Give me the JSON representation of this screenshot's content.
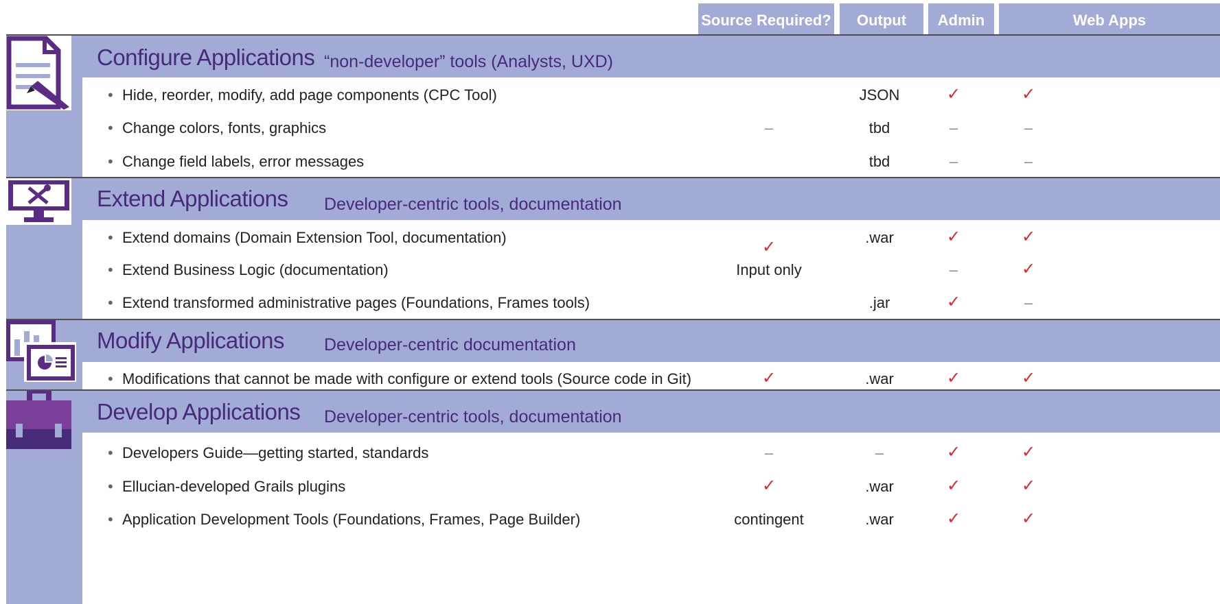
{
  "header": {
    "columns": [
      "Source Required?",
      "Output",
      "Admin",
      "Web Apps"
    ]
  },
  "sections": [
    {
      "title": "Configure Applications",
      "subtitle": "“non-developer” tools (Analysts, UXD)",
      "icon": "document-pencil-icon",
      "rows": [
        {
          "text": "Hide, reorder, modify, add page components (CPC Tool)",
          "source": "",
          "output": "JSON",
          "admin": "✓",
          "web": "✓"
        },
        {
          "text": "Change colors, fonts, graphics",
          "source": "–",
          "output": "tbd",
          "admin": "–",
          "web": "–"
        },
        {
          "text": "Change field labels, error messages",
          "source": "",
          "output": "tbd",
          "admin": "–",
          "web": "–"
        }
      ]
    },
    {
      "title": "Extend Applications",
      "subtitle": "Developer-centric tools, documentation",
      "icon": "monitor-tools-icon",
      "source_merged": {
        "check": "✓",
        "label": "Input only"
      },
      "rows": [
        {
          "text": "Extend domains (Domain Extension Tool, documentation)",
          "source": "",
          "output": ".war",
          "admin": "✓",
          "web": "✓"
        },
        {
          "text": "Extend Business Logic (documentation)",
          "source": "",
          "output": "",
          "admin": "–",
          "web": "✓"
        },
        {
          "text": "Extend transformed administrative pages (Foundations, Frames tools)",
          "source": "",
          "output": ".jar",
          "admin": "✓",
          "web": "–"
        }
      ]
    },
    {
      "title": "Modify Applications",
      "subtitle": "Developer-centric documentation",
      "icon": "dashboard-chart-icon",
      "rows": [
        {
          "text": "Modifications that cannot be made with configure or extend tools (Source code in Git)",
          "source": "✓",
          "output": ".war",
          "admin": "✓",
          "web": "✓"
        }
      ]
    },
    {
      "title": "Develop Applications",
      "subtitle": "Developer-centric tools, documentation",
      "icon": "toolbox-icon",
      "rows": [
        {
          "text": "Developers Guide—getting started, standards",
          "source": "–",
          "output": "–",
          "admin": "✓",
          "web": "✓"
        },
        {
          "text": "Ellucian-developed Grails plugins",
          "source": "✓",
          "output": ".war",
          "admin": "✓",
          "web": "✓"
        },
        {
          "text": "Application Development Tools (Foundations, Frames, Page Builder)",
          "source": "contingent",
          "output": ".war",
          "admin": "✓",
          "web": "✓"
        }
      ]
    }
  ],
  "bullet": "•",
  "colors": {
    "band": "#a2abd5",
    "title": "#472b78",
    "check": "#e8242b",
    "dash": "#8a8a8a"
  }
}
